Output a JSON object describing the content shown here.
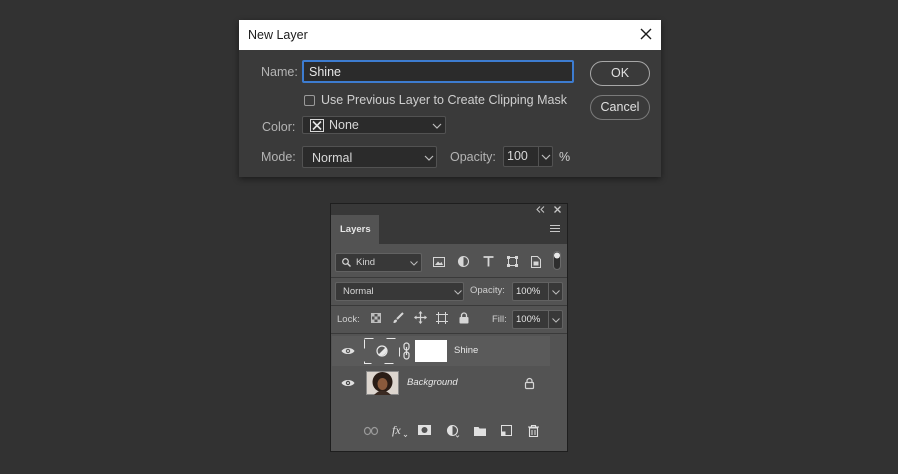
{
  "dialog": {
    "title": "New Layer",
    "name_label": "Name:",
    "name_value": "Shine",
    "clip_label": "Use Previous Layer to Create Clipping Mask",
    "clip_checked": false,
    "color_label": "Color:",
    "color_value": "None",
    "mode_label": "Mode:",
    "mode_value": "Normal",
    "opacity_label": "Opacity:",
    "opacity_value": "100",
    "opacity_unit": "%",
    "ok_label": "OK",
    "cancel_label": "Cancel"
  },
  "layers_panel": {
    "tab_label": "Layers",
    "filter_kind": "Kind",
    "blend_mode": "Normal",
    "opacity_label": "Opacity:",
    "opacity_value": "100%",
    "lock_label": "Lock:",
    "fill_label": "Fill:",
    "fill_value": "100%",
    "layers": [
      {
        "name": "Shine",
        "type": "adjustment",
        "visible": true,
        "selected": true
      },
      {
        "name": "Background",
        "type": "image",
        "visible": true,
        "locked": true
      }
    ]
  },
  "colors": {
    "canvas": "#323232",
    "dialog_bg": "#3a3a3a",
    "focus_blue": "#3d7cd0",
    "panel_bg": "#535353"
  }
}
